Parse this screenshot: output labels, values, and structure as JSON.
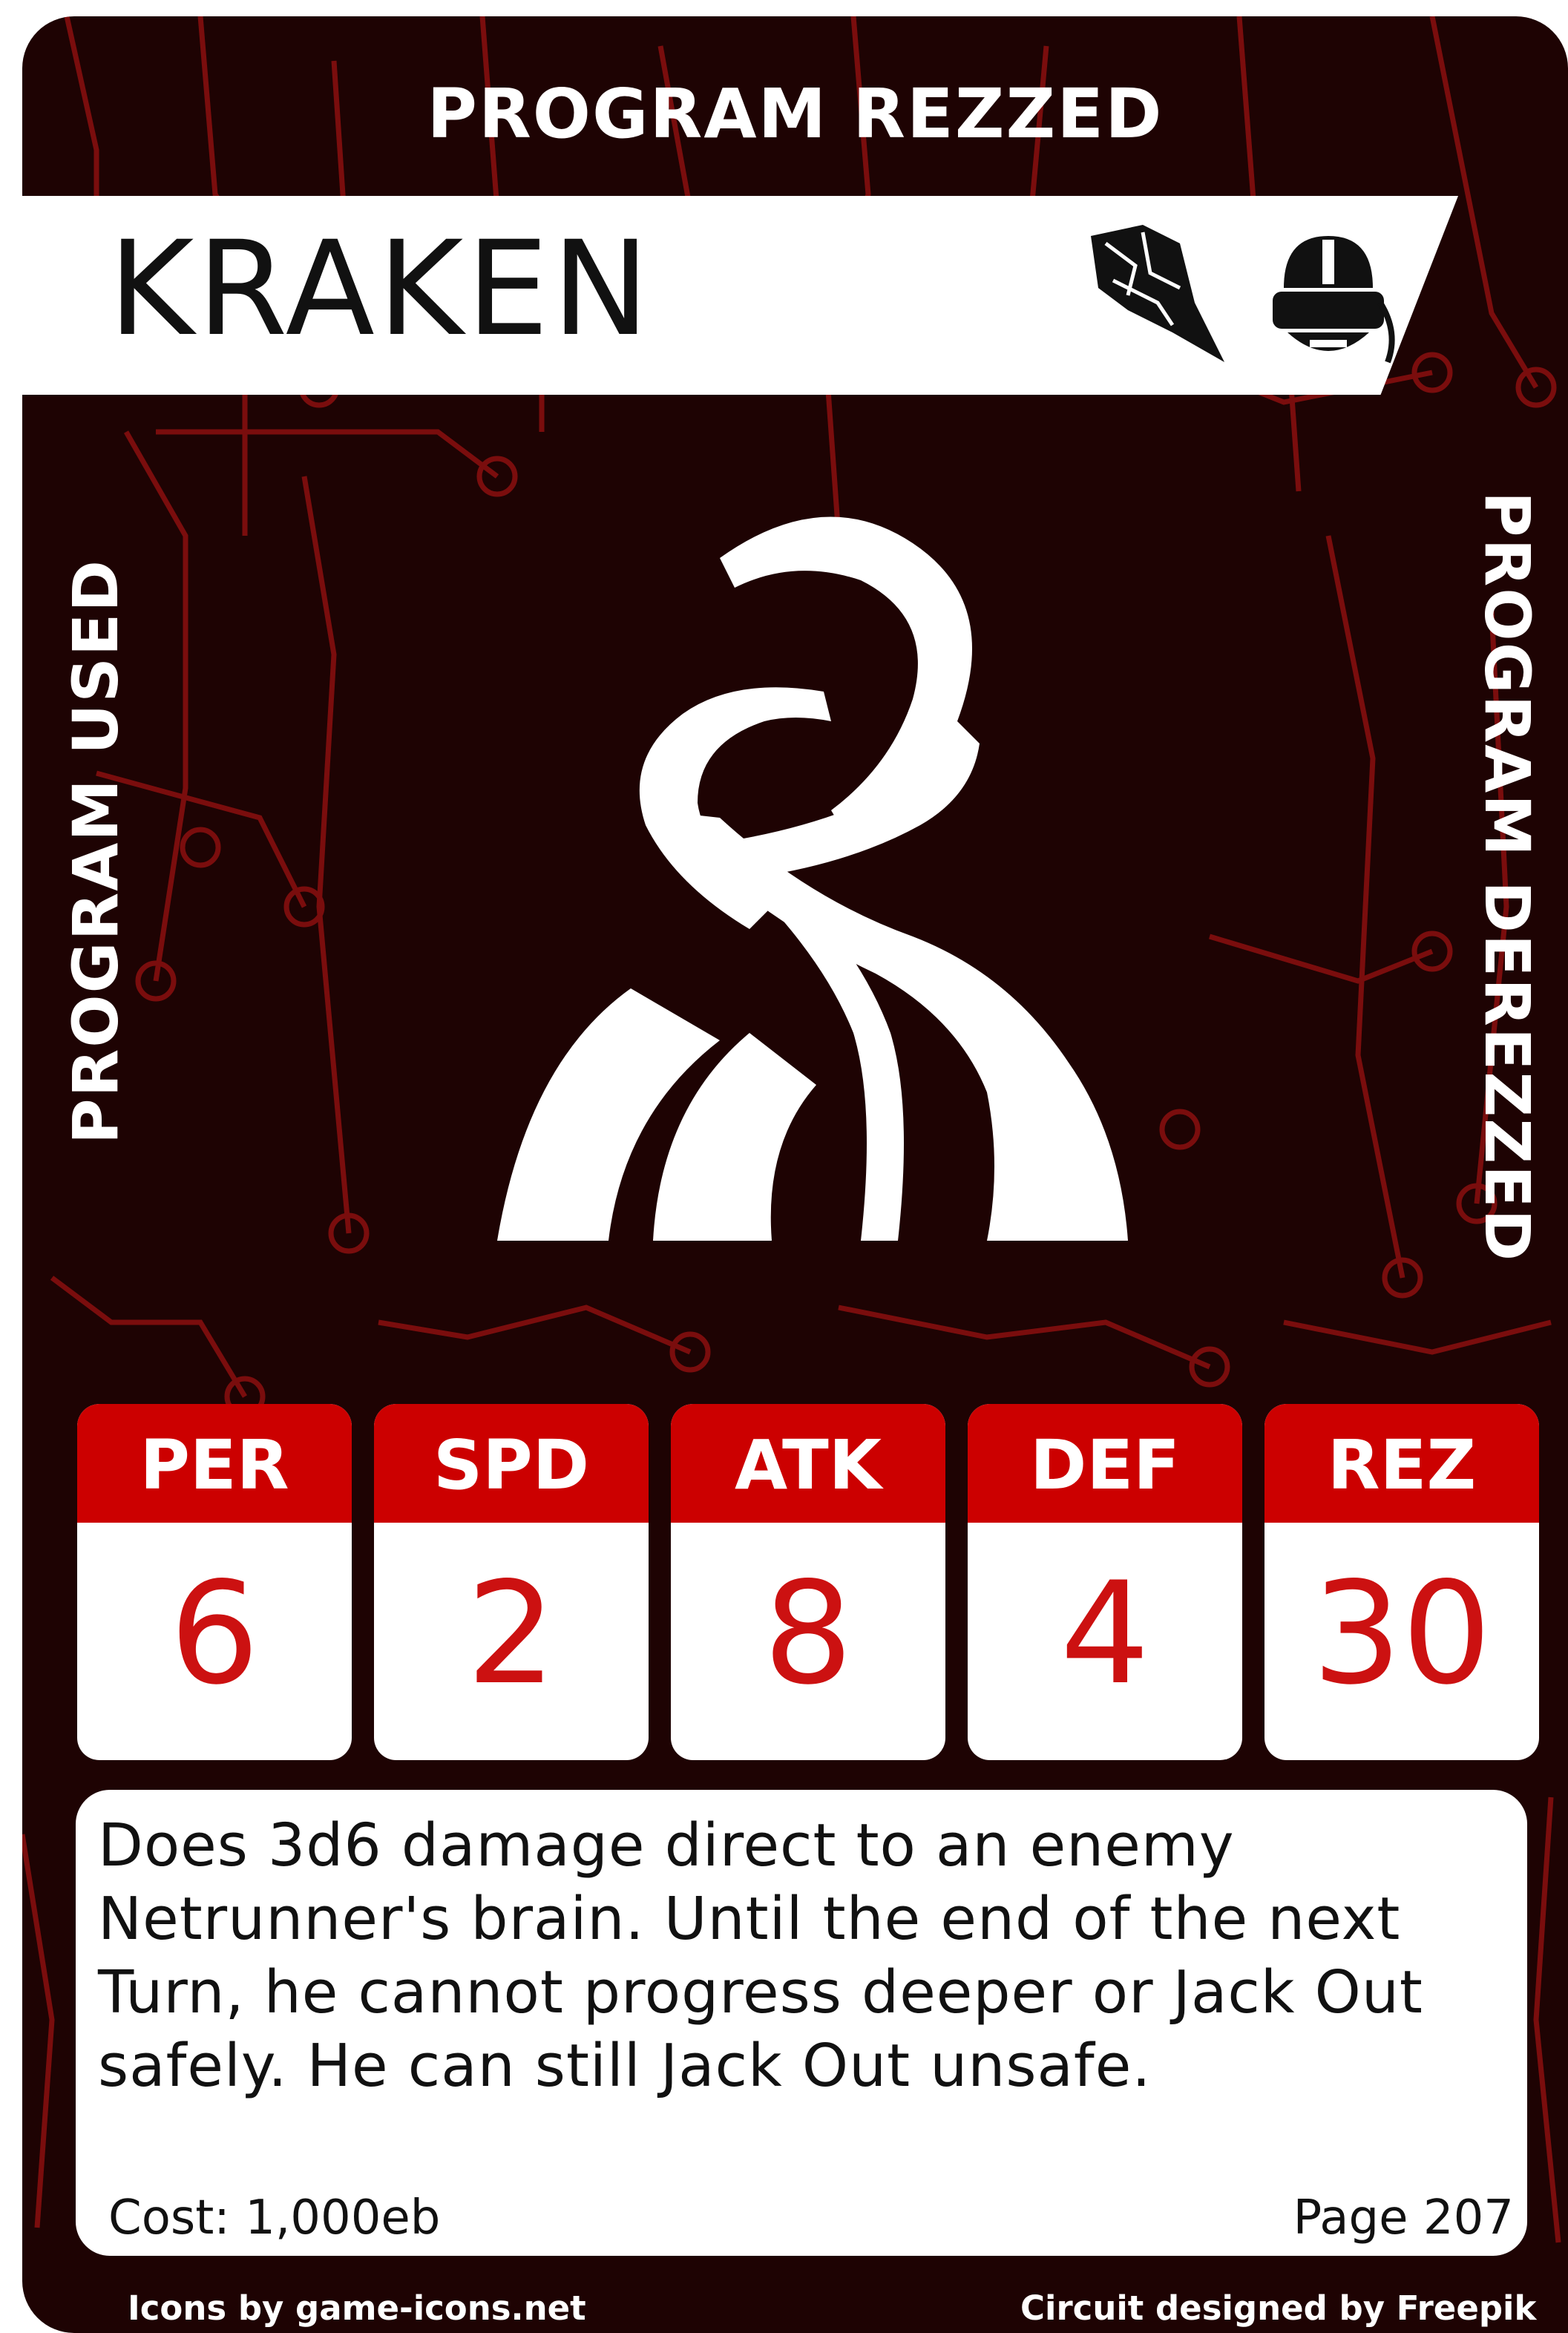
{
  "card": {
    "top_label": "PROGRAM REZZED",
    "name": "KRAKEN",
    "left_label": "PROGRAM USED",
    "right_label": "PROGRAM DEREZZED",
    "type_icons": [
      "shattered-glass-icon",
      "vr-headset-icon"
    ],
    "art_icon": "kraken-tentacles-icon",
    "stats": [
      {
        "label": "PER",
        "value": "6"
      },
      {
        "label": "SPD",
        "value": "2"
      },
      {
        "label": "ATK",
        "value": "8"
      },
      {
        "label": "DEF",
        "value": "4"
      },
      {
        "label": "REZ",
        "value": "30"
      }
    ],
    "description": "Does 3d6 damage direct to an enemy Netrunner's brain. Until the end of the next Turn, he cannot progress deeper or Jack Out safely. He can still Jack Out unsafe.",
    "cost": "Cost: 1,000eb",
    "page": "Page 207",
    "credit_icons": "Icons by game-icons.net",
    "credit_circuit": "Circuit designed by Freepik"
  },
  "colors": {
    "background": "#1e0303",
    "circuit": "#7a0d0d",
    "accent_red": "#cc0000",
    "value_red": "#cc1111",
    "white": "#ffffff"
  }
}
